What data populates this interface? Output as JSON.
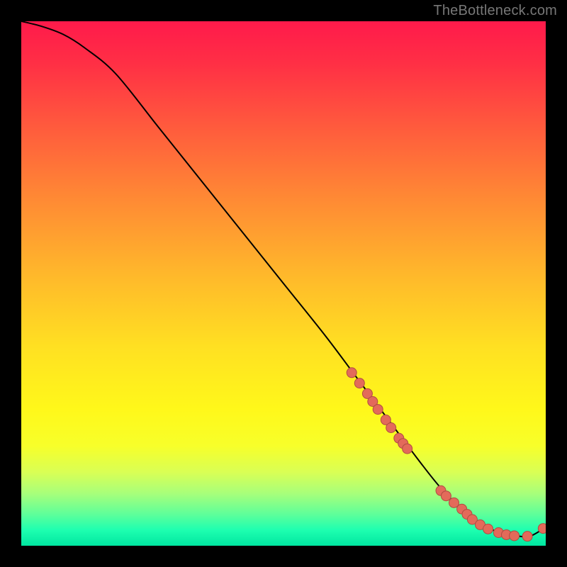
{
  "attribution": "TheBottleneck.com",
  "colors": {
    "page_bg": "#000000",
    "curve": "#000000",
    "marker_fill": "#e36a5a",
    "marker_stroke": "#b04d42",
    "gradient_top": "#ff1a4b",
    "gradient_bottom": "#00e6a0"
  },
  "chart_data": {
    "type": "line",
    "title": "",
    "xlabel": "",
    "ylabel": "",
    "xlim": [
      0,
      100
    ],
    "ylim": [
      0,
      100
    ],
    "series": [
      {
        "name": "curve",
        "x": [
          0,
          4,
          8,
          12,
          18,
          26,
          34,
          42,
          50,
          58,
          64,
          70,
          76,
          80,
          84,
          88,
          92,
          95,
          97,
          100
        ],
        "y": [
          100,
          99,
          97.5,
          95,
          90,
          80,
          70,
          60,
          50,
          40,
          32,
          24,
          16,
          11,
          7,
          4,
          2.2,
          1.8,
          1.8,
          3.5
        ]
      }
    ],
    "markers": {
      "name": "highlight-points",
      "x": [
        63,
        64.5,
        66,
        67,
        68,
        69.5,
        70.5,
        72,
        72.8,
        73.6,
        80,
        81,
        82.5,
        84,
        85,
        86,
        87.5,
        89,
        91,
        92.5,
        94,
        96.5,
        99.5
      ],
      "y": [
        33,
        31,
        29,
        27.5,
        26,
        24,
        22.5,
        20.5,
        19.5,
        18.5,
        10.5,
        9.5,
        8.2,
        7,
        6,
        5,
        4,
        3.2,
        2.5,
        2.1,
        1.9,
        1.8,
        3.3
      ]
    }
  }
}
